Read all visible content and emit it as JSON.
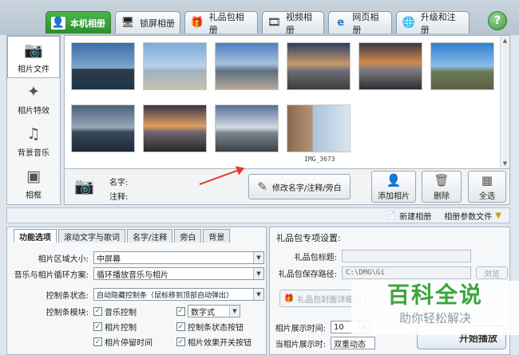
{
  "tabs": [
    {
      "label": "本机相册",
      "icon": "person-photo-icon"
    },
    {
      "label": "锁屏相册",
      "icon": "monitor-icon"
    },
    {
      "label": "礼品包相册",
      "icon": "gift-icon"
    },
    {
      "label": "视频相册",
      "icon": "film-icon"
    },
    {
      "label": "网页相册",
      "icon": "ie-icon"
    },
    {
      "label": "升级和注册",
      "icon": "globe-icon"
    }
  ],
  "help_label": "?",
  "left_nav": [
    {
      "label": "相片文件",
      "icon": "camera-icon"
    },
    {
      "label": "相片特效",
      "icon": "effects-icon"
    },
    {
      "label": "背景音乐",
      "icon": "music-icon"
    },
    {
      "label": "相框",
      "icon": "frame-icon"
    }
  ],
  "gallery": {
    "selected_caption": "IMG_3673",
    "photo_count": 10
  },
  "info": {
    "name_label": "名字:",
    "note_label": "注释:",
    "edit_button": "修改名字/注释/旁白",
    "add_button": "添加相片",
    "delete_button": "删除",
    "select_all_button": "全选"
  },
  "strip": {
    "new_album": "新建相册",
    "params_file": "相册参数文件"
  },
  "options": {
    "tabs": [
      "功能选项",
      "滚动文字与歌词",
      "名字/注释",
      "旁白",
      "背景"
    ],
    "photo_area_label": "相片区域大小:",
    "photo_area_value": "中屏幕",
    "music_loop_label": "音乐与相片循环方案:",
    "music_loop_value": "循环播放音乐与相片",
    "control_bar_label": "控制条状态:",
    "control_bar_value": "自动隐藏控制条（鼠标移到顶部自动弹出）",
    "control_module_label": "控制条模块:",
    "checks": [
      {
        "label": "音乐控制",
        "checked": true
      },
      {
        "label": "数字式",
        "checked": true,
        "is_select": true
      },
      {
        "label": "相片控制",
        "checked": true
      },
      {
        "label": "控制条状态按钮",
        "checked": true
      },
      {
        "label": "相片停留时间",
        "checked": true
      },
      {
        "label": "相片效果开关按钮",
        "checked": true
      }
    ]
  },
  "gift": {
    "title": "礼品包专项设置:",
    "gift_title_label": "礼品包标题:",
    "gift_title_value": "",
    "save_path_label": "礼品包保存路径:",
    "save_path_value": "C:\\DMG\\Gi",
    "browse_label": "浏览",
    "cover_button": "礼品包封面详细设",
    "interval_label": "相片展示时间:",
    "interval_value": "10",
    "mode_label": "当相片展示时:",
    "mode_value": "双重动态",
    "play_button": "开始播放"
  },
  "watermark": {
    "title": "百科全说",
    "subtitle": "助你轻松解决"
  }
}
